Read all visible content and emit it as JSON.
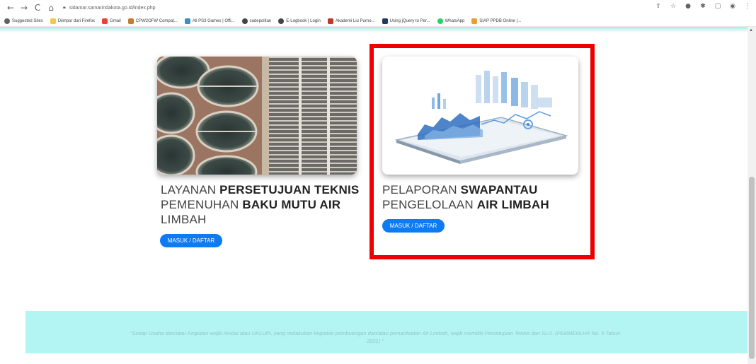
{
  "browser": {
    "url": "sidamar.samarindakota.go.id/index.php",
    "bookmarks": [
      {
        "label": "Suggested Sites",
        "color": "#5f6368"
      },
      {
        "label": "Diimpor dari Firefox",
        "color": "#f6c744"
      },
      {
        "label": "Gmail",
        "color": "#ea4335"
      },
      {
        "label": "CPW2OFW Compat...",
        "color": "#c77c2e"
      },
      {
        "label": "All PS3 Games | Offi...",
        "color": "#3a8ec8"
      },
      {
        "label": "codepolitan",
        "color": "#444444"
      },
      {
        "label": "E-Logbook | Login",
        "color": "#444444"
      },
      {
        "label": "Akademi Liu Purno...",
        "color": "#c0392b"
      },
      {
        "label": "Using jQuery to Per...",
        "color": "#1e3a5f"
      },
      {
        "label": "WhatsApp",
        "color": "#25d366"
      },
      {
        "label": "SIAP PPDB Online |...",
        "color": "#e5a02e"
      }
    ]
  },
  "cards": [
    {
      "title_pre": "LAYANAN ",
      "title_bold1": "PERSETUJUAN TEKNIS",
      "title_mid": " PEMENUHAN ",
      "title_bold2": "BAKU MUTU AIR",
      "title_post": " LIMBAH",
      "button": "MASUK / DAFTAR"
    },
    {
      "title_pre": "PELAPORAN ",
      "title_bold1": "SWAPANTAU",
      "title_mid": " PENGELOLAAN ",
      "title_bold2": "AIR LIMBAH",
      "title_post": "",
      "button": "MASUK / DAFTAR"
    }
  ],
  "footer": {
    "quote": "\"Setiap Usaha dan/atau Kegiatan wajib Amdal atau UKLUPL yang melakukan kegiatan pembuangan dan/atau pemanfaatan Air Limbah, wajib memiliki Persetujuan Teknis dan SLO. (PERMENLHK No. 5 Tahun 2021) \""
  },
  "colors": {
    "accent_button": "#0d7bf2",
    "highlight_border": "#ee0000",
    "footer_bg": "#b2f5f3"
  }
}
